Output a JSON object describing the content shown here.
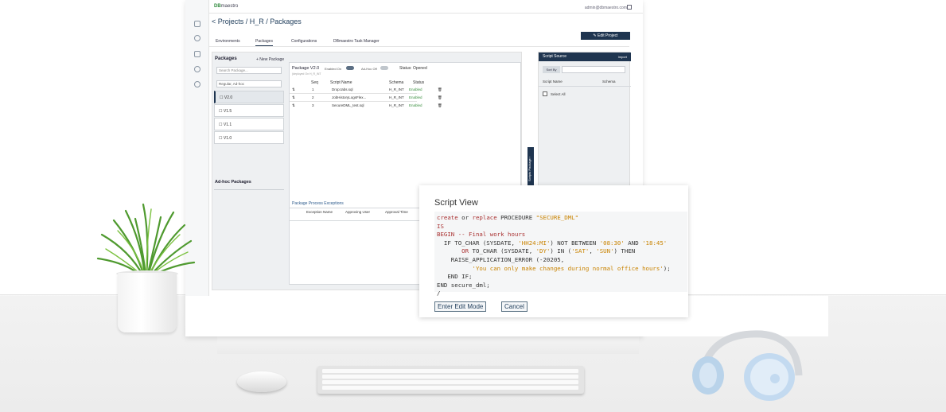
{
  "app": {
    "brand_prefix": "DB",
    "brand_rest": "maestro",
    "user_email": "admin@dbmaestro.com",
    "breadcrumb": "< Projects / H_R / Packages",
    "edit_project_label": "Edit Project",
    "tabs": [
      {
        "label": "Environments",
        "active": false
      },
      {
        "label": "Packages",
        "active": true
      },
      {
        "label": "Configurations",
        "active": false
      },
      {
        "label": "DBmaestro Task Manager",
        "active": false
      }
    ]
  },
  "packages": {
    "title": "Packages",
    "new_package_label": "+ New Package",
    "search_placeholder": "Search Package...",
    "filter_value": "Regular, Ad-hoc",
    "versions": [
      {
        "label": "V2.0",
        "active": true
      },
      {
        "label": "V1.5",
        "active": false
      },
      {
        "label": "V1.1",
        "active": false
      },
      {
        "label": "V1.0",
        "active": false
      }
    ],
    "adhoc_title": "Ad-hoc Packages"
  },
  "package_view": {
    "title": "Package V2.0",
    "subtitle": "(deployed On H_R_INT",
    "enabled_label": "Enabled On",
    "adhoc_label": "Ad-Hoc Off",
    "status": "Status: Opened",
    "columns": [
      "Seq",
      "Script Name",
      "Schema",
      "Status"
    ],
    "rows": [
      {
        "seq": "1",
        "name": "Drop.tabs.sql",
        "schema": "H_R_INT",
        "status": "Enabled"
      },
      {
        "seq": "2",
        "name": "JobHistoryLogsFlex...",
        "schema": "H_R_INT",
        "status": "Enabled"
      },
      {
        "seq": "3",
        "name": "SecureDML_test.sql",
        "schema": "H_R_INT",
        "status": "Enabled"
      }
    ],
    "exceptions_title": "Package Process Exceptions",
    "exceptions_columns": [
      "Exception Name",
      "Approving User",
      "Approval Time"
    ],
    "assoc_tab": "Scripts Package ‹"
  },
  "script_source": {
    "title": "Script Source",
    "import_label": "Import",
    "sort_label": "Sort By",
    "columns": [
      "Script Name",
      "Schema"
    ],
    "select_all": "Select All"
  },
  "script_view": {
    "title": "Script View",
    "edit_button": "Enter Edit Mode",
    "cancel_button": "Cancel",
    "code": {
      "l1a": "create",
      "l1b": " or ",
      "l1c": "replace",
      "l1d": " PROCEDURE ",
      "l1e": "\"SECURE_DML\"",
      "l2": "IS",
      "l3": "BEGIN -- Final work hours",
      "l4a": "  IF TO_CHAR (SYSDATE, ",
      "l4b": "'HH24:MI'",
      "l4c": ") NOT BETWEEN ",
      "l4d": "'08:30'",
      "l4e": " AND ",
      "l4f": "'18:45'",
      "l5a": "       OR",
      "l5b": " TO_CHAR (SYSDATE, ",
      "l5c": "'DY'",
      "l5d": ") IN (",
      "l5e": "'SAT'",
      "l5f": ", ",
      "l5g": "'SUN'",
      "l5h": ") THEN",
      "l6": "    RAISE_APPLICATION_ERROR (-20205,",
      "l7": "          'You can only make changes during normal office hours'",
      "l7b": ");",
      "l8": "   END IF;",
      "l9": "END secure_dml;",
      "l10": "/"
    }
  }
}
